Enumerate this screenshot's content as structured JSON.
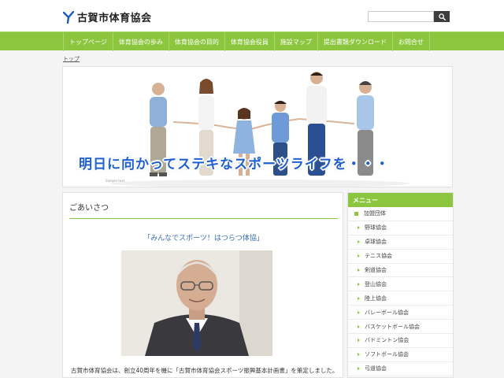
{
  "site": {
    "title": "古賀市体育協会",
    "search_placeholder": "",
    "brand_color": "#8cc63f",
    "accent_color": "#1f5fd0"
  },
  "nav": {
    "items": [
      {
        "label": "トップページ"
      },
      {
        "label": "体育協会の歩み"
      },
      {
        "label": "体育協会の目的"
      },
      {
        "label": "体育協会役員"
      },
      {
        "label": "施設マップ"
      },
      {
        "label": "提出書類ダウンロード"
      },
      {
        "label": "お問合せ"
      }
    ]
  },
  "breadcrumb": {
    "label": "トップ"
  },
  "hero": {
    "caption": "明日に向かってステキなスポーツライフを・・・",
    "small_text": "Sample text"
  },
  "main": {
    "heading": "ごあいさつ",
    "slogan": "「みんなでスポーツ！はつらつ体協」",
    "intro": "古賀市体育協会は、創立40周年を機に「古賀市体育協会スポーツ振興基本計画書」を策定しました。"
  },
  "sidebar": {
    "heading": "メニュー",
    "top_item": "加盟団体",
    "items": [
      {
        "label": "野球協会"
      },
      {
        "label": "卓球協会"
      },
      {
        "label": "テニス協会"
      },
      {
        "label": "剣道協会"
      },
      {
        "label": "登山協会"
      },
      {
        "label": "陸上協会"
      },
      {
        "label": "バレーボール協会"
      },
      {
        "label": "バスケットボール協会"
      },
      {
        "label": "バドミントン協会"
      },
      {
        "label": "ソフトボール協会"
      },
      {
        "label": "弓道協会"
      }
    ]
  }
}
